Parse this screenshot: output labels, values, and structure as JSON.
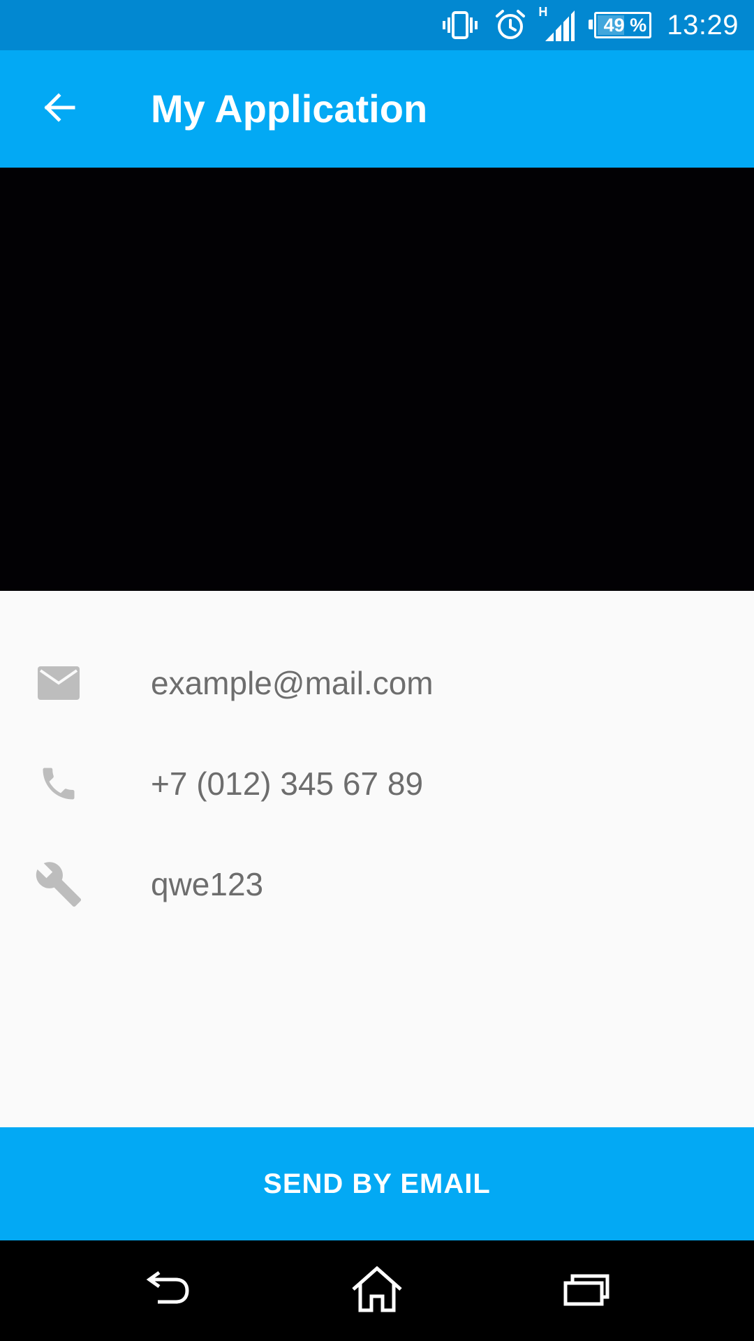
{
  "status_bar": {
    "network_type": "H",
    "battery_percent": "49 %",
    "battery_level": 0.49,
    "time": "13:29",
    "icons": [
      "vibrate-icon",
      "alarm-icon",
      "signal-icon",
      "battery-icon"
    ]
  },
  "app_bar": {
    "title": "My Application",
    "back_icon": "arrow-back-icon"
  },
  "details": [
    {
      "icon": "email-icon",
      "value": "example@mail.com"
    },
    {
      "icon": "phone-icon",
      "value": "+7 (012) 345 67 89"
    },
    {
      "icon": "wrench-icon",
      "value": "qwe123"
    }
  ],
  "actions": {
    "send_label": "SEND BY EMAIL"
  },
  "nav_bar": {
    "icons": [
      "back-nav-icon",
      "home-icon",
      "recents-icon"
    ]
  },
  "colors": {
    "status_bar": "#0288d1",
    "primary": "#03a9f4",
    "content_bg": "#fafafa",
    "text_secondary": "#6d6d6d",
    "icon_gray": "#bdbdbd"
  }
}
